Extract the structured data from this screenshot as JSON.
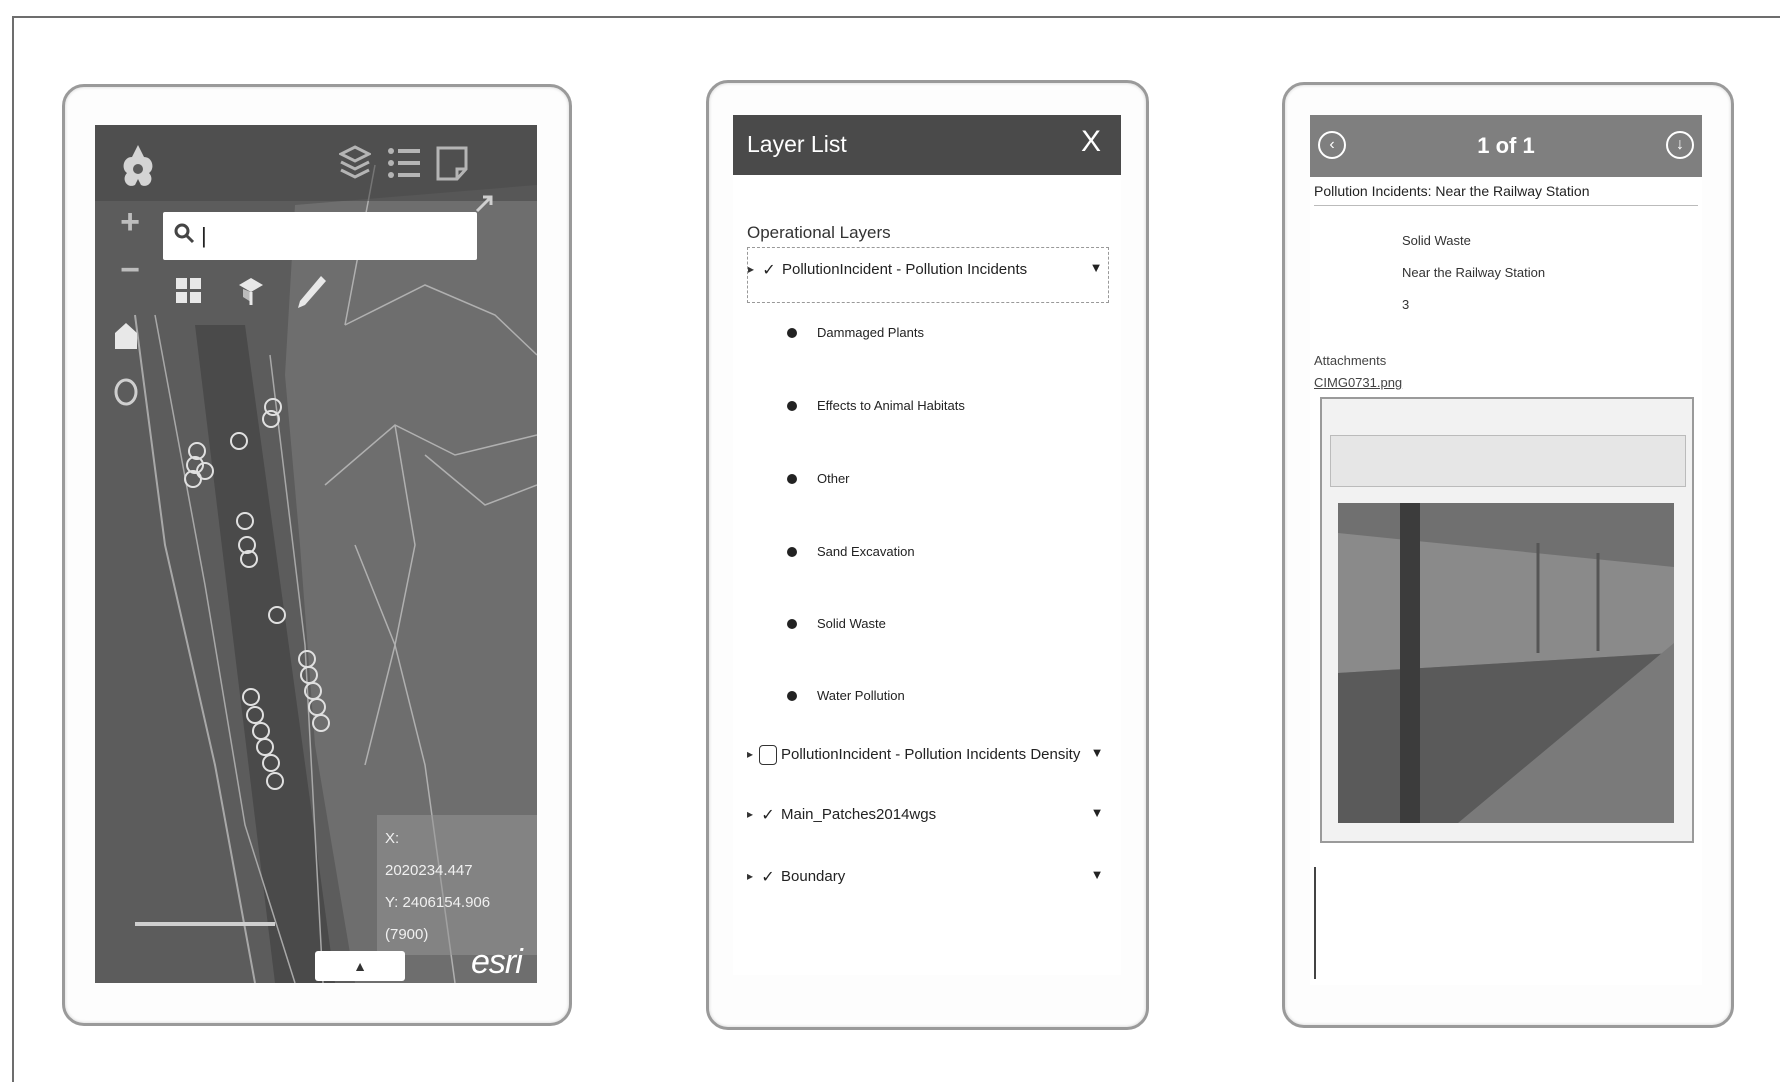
{
  "map_app": {
    "search": {
      "value": "|",
      "placeholder": ""
    },
    "zoom_in": "+",
    "zoom_out": "−",
    "coords": {
      "x": "X:",
      "x_value": "2020234.447",
      "y": "Y: 2406154.906",
      "extra": "(7900)"
    },
    "esri": "esri",
    "icons": [
      "app-logo-icon",
      "layers-icon",
      "legend-icon",
      "about-icon",
      "search-icon",
      "home-icon",
      "locate-icon",
      "basemap-gallery-icon",
      "edit-icon",
      "measure-icon",
      "expand-icon"
    ]
  },
  "layer_list": {
    "title": "Layer List",
    "close": "X",
    "section": "Operational Layers",
    "layers": [
      {
        "name": "PollutionIncident - Pollution Incidents",
        "visible": true,
        "expanded": true
      },
      {
        "name": "PollutionIncident - Pollution Incidents Density",
        "visible": false
      },
      {
        "name": "Main_Patches2014wgs",
        "visible": true
      },
      {
        "name": "Boundary",
        "visible": true
      }
    ],
    "sublayers": [
      "Dammaged Plants",
      "Effects to Animal Habitats",
      "Other",
      "Sand Excavation",
      "Solid Waste",
      "Water Pollution"
    ]
  },
  "popup": {
    "count": "1 of 1",
    "prev": "‹",
    "next": "↓",
    "title": "Pollution Incidents: Near the Railway Station",
    "fields": [
      {
        "key": "",
        "value": "Solid Waste"
      },
      {
        "key": "",
        "value": "Near the Railway Station"
      },
      {
        "key": "",
        "value": "3"
      }
    ],
    "attachments_label": "Attachments",
    "attachment_file": "CIMG0731.png"
  }
}
